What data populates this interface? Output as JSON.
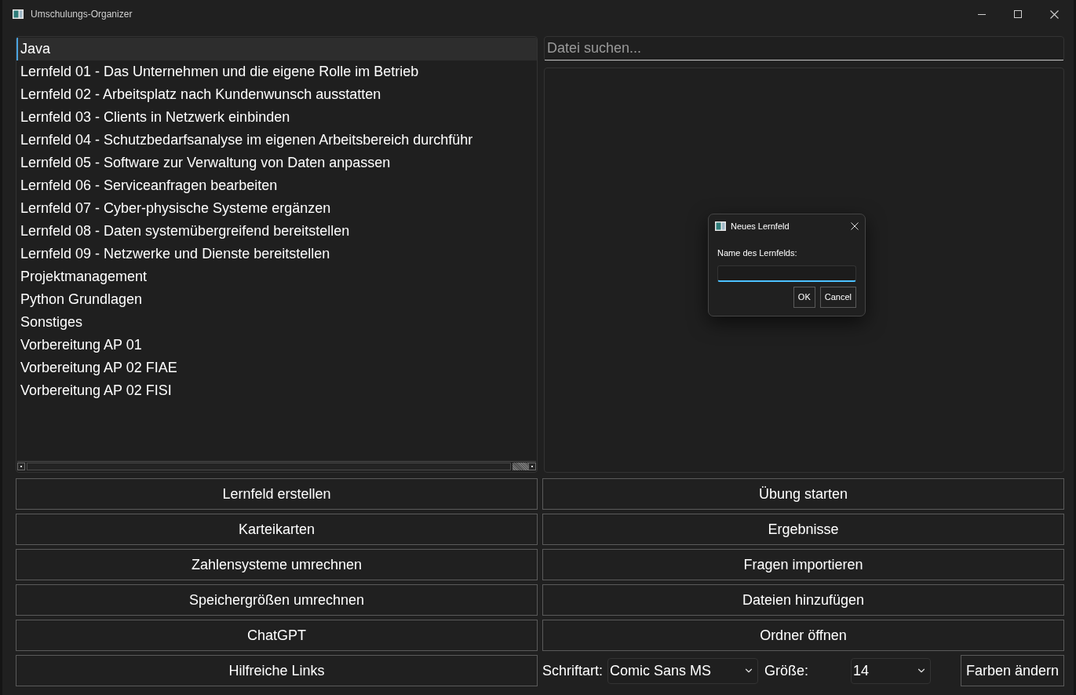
{
  "window": {
    "title": "Umschulungs-Organizer"
  },
  "lernfeld_list": {
    "items": [
      {
        "label": "Java",
        "selected": true
      },
      {
        "label": "Lernfeld 01 - Das Unternehmen und die eigene Rolle im Betrieb",
        "selected": false
      },
      {
        "label": "Lernfeld 02 - Arbeitsplatz nach Kundenwunsch ausstatten",
        "selected": false
      },
      {
        "label": "Lernfeld 03 - Clients in Netzwerk einbinden",
        "selected": false
      },
      {
        "label": "Lernfeld 04 - Schutzbedarfsanalyse im eigenen Arbeitsbereich durchführ",
        "selected": false
      },
      {
        "label": "Lernfeld 05 - Software zur Verwaltung von Daten anpassen",
        "selected": false
      },
      {
        "label": "Lernfeld 06 - Serviceanfragen bearbeiten",
        "selected": false
      },
      {
        "label": "Lernfeld 07 - Cyber-physische Systeme ergänzen",
        "selected": false
      },
      {
        "label": "Lernfeld 08 - Daten systemübergreifend bereitstellen",
        "selected": false
      },
      {
        "label": "Lernfeld 09 - Netzwerke und Dienste bereitstellen",
        "selected": false
      },
      {
        "label": "Projektmanagement",
        "selected": false
      },
      {
        "label": "Python Grundlagen",
        "selected": false
      },
      {
        "label": "Sonstiges",
        "selected": false
      },
      {
        "label": "Vorbereitung AP 01",
        "selected": false
      },
      {
        "label": "Vorbereitung AP 02 FIAE",
        "selected": false
      },
      {
        "label": "Vorbereitung AP 02 FISI",
        "selected": false
      }
    ]
  },
  "search": {
    "placeholder": "Datei suchen..."
  },
  "buttons": [
    "Lernfeld erstellen",
    "Übung starten",
    "Karteikarten",
    "Ergebnisse",
    "Zahlensysteme umrechnen",
    "Fragen importieren",
    "Speichergrößen umrechnen",
    "Dateien hinzufügen",
    "ChatGPT",
    "Ordner öffnen",
    "Hilfreiche Links"
  ],
  "font_bar": {
    "font_label": "Schriftart:",
    "font_value": "Comic Sans MS",
    "size_label": "Größe:",
    "size_value": "14",
    "color_button": "Farben ändern"
  },
  "dialog": {
    "title": "Neues Lernfeld",
    "label": "Name des Lernfelds:",
    "input": {
      "focused": true
    },
    "buttons": [
      "OK",
      "Cancel"
    ]
  }
}
